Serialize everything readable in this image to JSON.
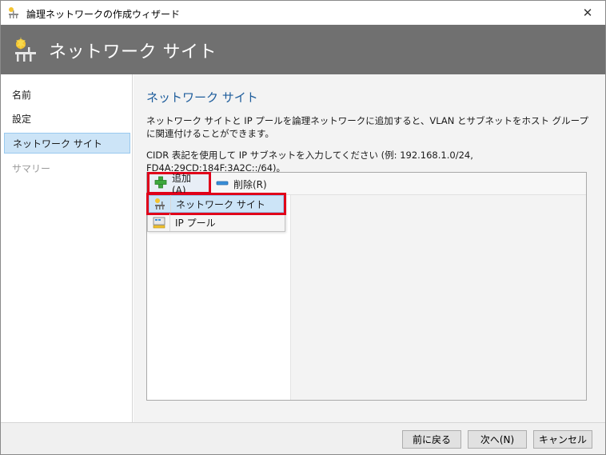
{
  "window": {
    "title": "論理ネットワークの作成ウィザード",
    "close_label": "✕"
  },
  "banner": {
    "title": "ネットワーク サイト"
  },
  "sidebar": {
    "items": [
      {
        "label": "名前",
        "state": "normal"
      },
      {
        "label": "設定",
        "state": "normal"
      },
      {
        "label": "ネットワーク サイト",
        "state": "active"
      },
      {
        "label": "サマリー",
        "state": "disabled"
      }
    ]
  },
  "main": {
    "heading": "ネットワーク サイト",
    "description": "ネットワーク サイトと IP プールを論理ネットワークに追加すると、VLAN とサブネットをホスト グループに関連付けることができます。",
    "hint": "CIDR 表記を使用して IP サブネットを入力してください (例: 192.168.1.0/24, FD4A:29CD:184F:3A2C::/64)。",
    "toolbar": {
      "add_label": "追加(A)",
      "remove_label": "削除(R)"
    },
    "add_menu": [
      {
        "label": "ネットワーク サイト",
        "icon": "network-site-icon",
        "highlighted": true
      },
      {
        "label": "IP プール",
        "icon": "ip-pool-icon",
        "highlighted": false
      }
    ]
  },
  "footer": {
    "back_label": "前に戻る",
    "next_label": "次へ(N)",
    "cancel_label": "キャンセル"
  },
  "colors": {
    "banner": "#707070",
    "heading": "#1e5d9c",
    "highlight": "#cce4f7",
    "annotation_red": "#e0001a"
  }
}
